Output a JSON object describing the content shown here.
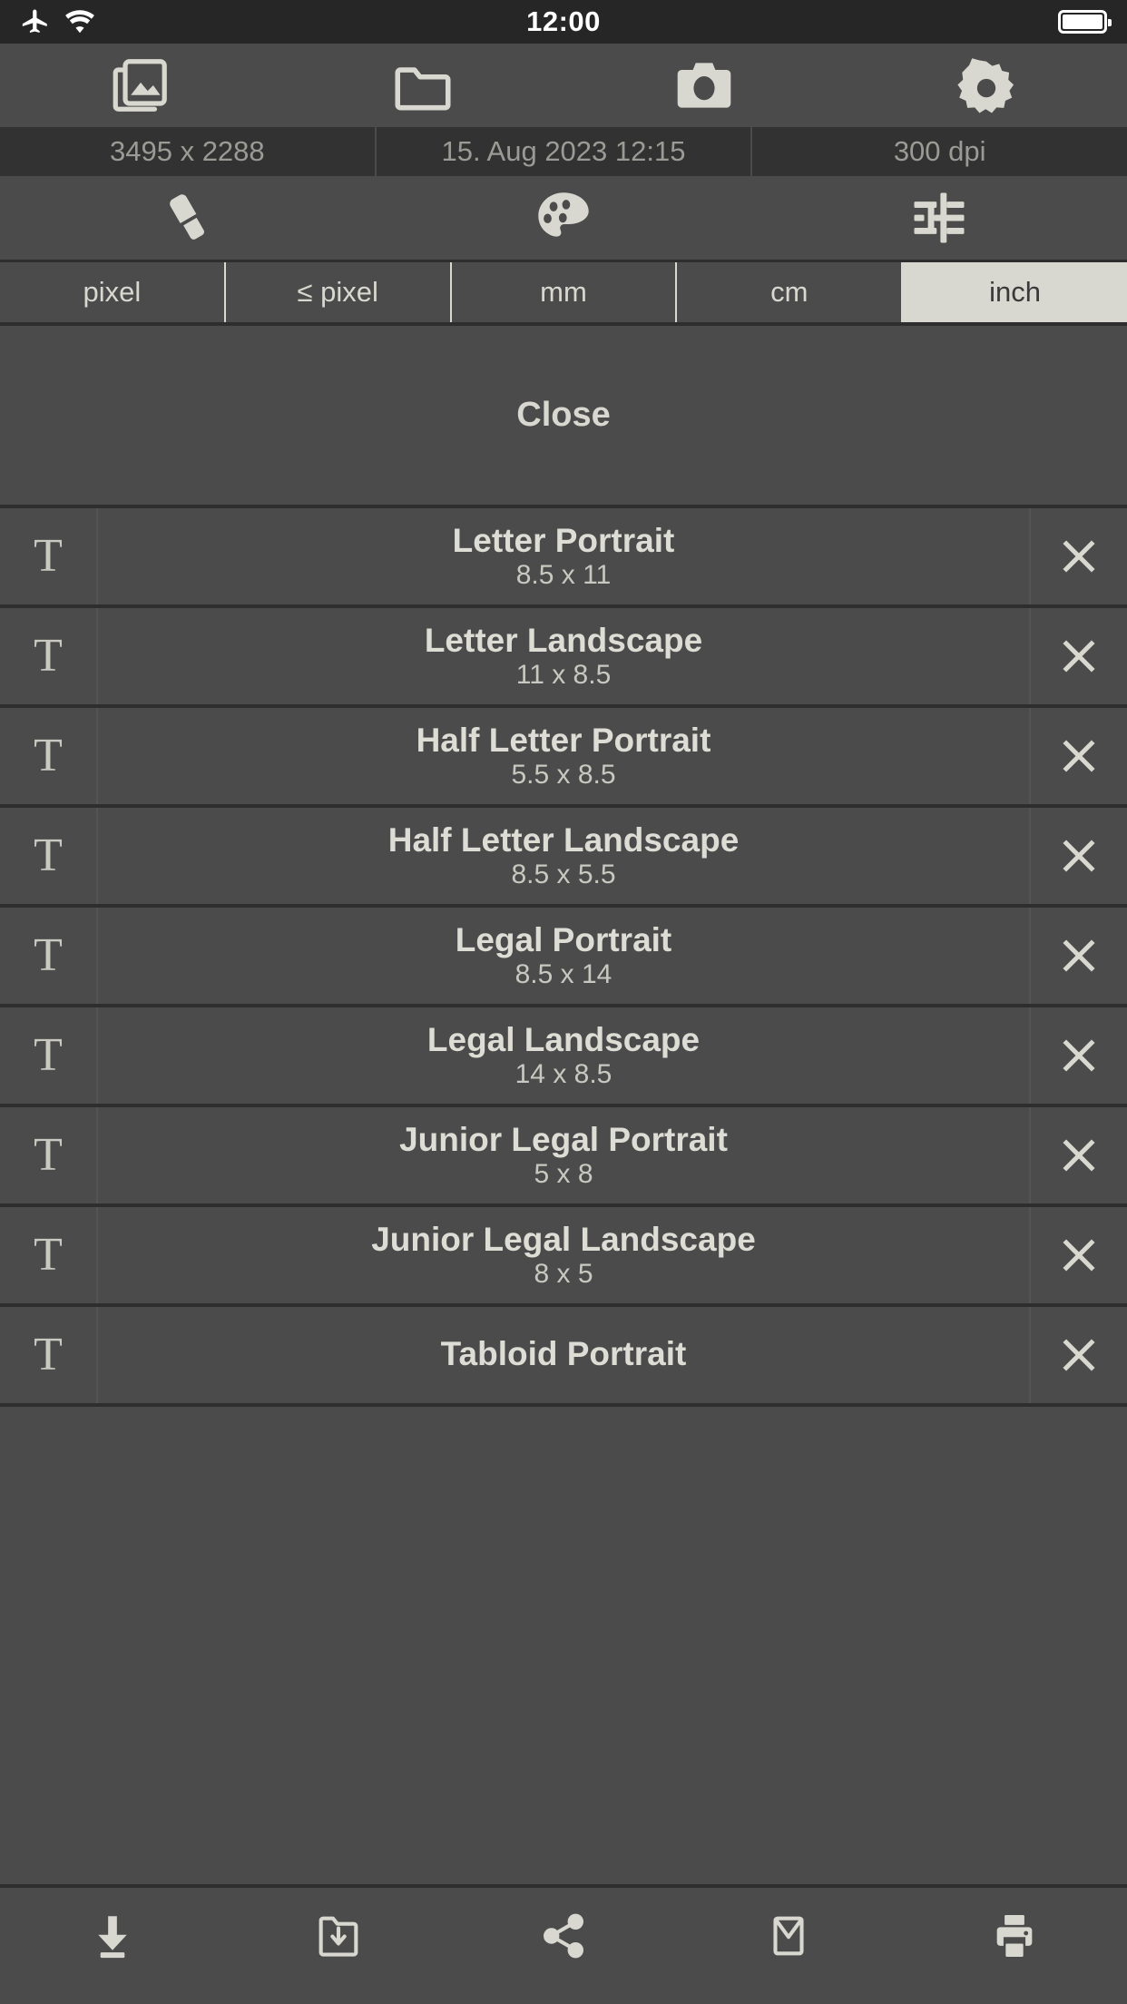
{
  "status_bar": {
    "time": "12:00",
    "airplane_icon": "airplane-mode-icon",
    "wifi_icon": "wifi-icon",
    "battery_icon": "battery-full-icon"
  },
  "top_toolbar": {
    "buttons": [
      {
        "name": "gallery",
        "icon": "gallery-icon"
      },
      {
        "name": "folder",
        "icon": "folder-icon"
      },
      {
        "name": "camera",
        "icon": "camera-icon"
      },
      {
        "name": "settings",
        "icon": "gear-icon"
      }
    ]
  },
  "info_bar": {
    "dimensions": "3495 x 2288",
    "datetime": "15. Aug 2023 12:15",
    "resolution": "300 dpi"
  },
  "tools_toolbar": {
    "buttons": [
      {
        "name": "eraser",
        "icon": "eraser-icon"
      },
      {
        "name": "palette",
        "icon": "palette-icon"
      },
      {
        "name": "adjustments",
        "icon": "sliders-icon"
      }
    ]
  },
  "unit_tabs": {
    "selected": "inch",
    "items": [
      {
        "label": "pixel",
        "active": false
      },
      {
        "label": "≤ pixel",
        "active": false
      },
      {
        "label": "mm",
        "active": false
      },
      {
        "label": "cm",
        "active": false
      },
      {
        "label": "inch",
        "active": true
      }
    ]
  },
  "close_panel": {
    "label": "Close"
  },
  "paper_list": {
    "left_icon": "text-tool-icon",
    "left_icon_glyph": "T",
    "right_icon": "close-icon",
    "rows": [
      {
        "title": "Letter Portrait",
        "size": "8.5 x 11"
      },
      {
        "title": "Letter Landscape",
        "size": "11 x 8.5"
      },
      {
        "title": "Half Letter Portrait",
        "size": "5.5 x 8.5"
      },
      {
        "title": "Half Letter Landscape",
        "size": "8.5 x 5.5"
      },
      {
        "title": "Legal Portrait",
        "size": "8.5 x 14"
      },
      {
        "title": "Legal Landscape",
        "size": "14 x 8.5"
      },
      {
        "title": "Junior Legal Portrait",
        "size": "5 x 8"
      },
      {
        "title": "Junior Legal Landscape",
        "size": "8 x 5"
      },
      {
        "title": "Tabloid Portrait",
        "size": ""
      }
    ]
  },
  "bottom_toolbar": {
    "buttons": [
      {
        "name": "download",
        "icon": "download-icon"
      },
      {
        "name": "save-to-folder",
        "icon": "folder-download-icon"
      },
      {
        "name": "share",
        "icon": "share-icon"
      },
      {
        "name": "mail",
        "icon": "mail-icon"
      },
      {
        "name": "print",
        "icon": "printer-icon"
      }
    ]
  },
  "colors": {
    "background": "#4b4b4b",
    "status_bar": "#262626",
    "info_bar": "#323232",
    "divider": "#2e2e2e",
    "text": "#d8d8d0",
    "accent_selected": "#d8d8d0"
  }
}
